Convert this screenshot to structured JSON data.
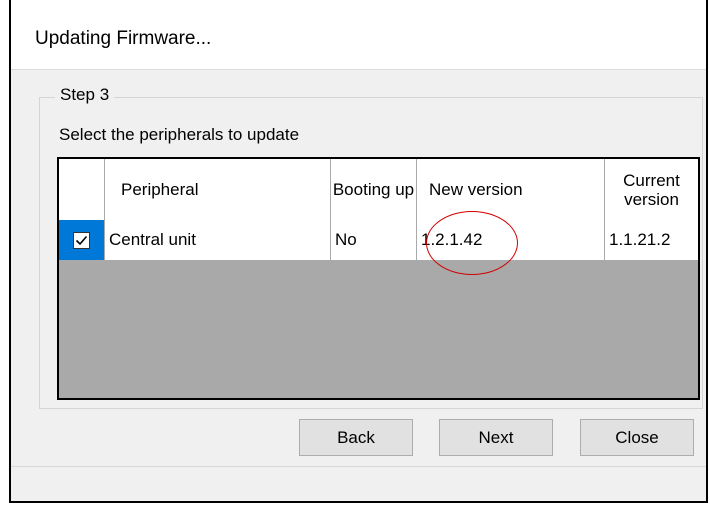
{
  "window": {
    "title": "Updating Firmware..."
  },
  "step": {
    "group_title": "Step 3",
    "instruction": "Select the peripherals to update"
  },
  "grid": {
    "columns": [
      "",
      "Peripheral",
      "Booting up",
      "New version",
      "Current version"
    ],
    "rows": [
      {
        "checked": true,
        "peripheral": "Central unit",
        "booting_up": "No",
        "new_version": "1.2.1.42",
        "current_version": "1.1.21.2"
      }
    ]
  },
  "buttons": {
    "back": "Back",
    "next": "Next",
    "close": "Close"
  },
  "colors": {
    "selection": "#0078d7",
    "grid_empty": "#a9a9a9",
    "highlight": "#d00000"
  },
  "icons": {
    "row_checkbox": "checkmark-icon"
  }
}
